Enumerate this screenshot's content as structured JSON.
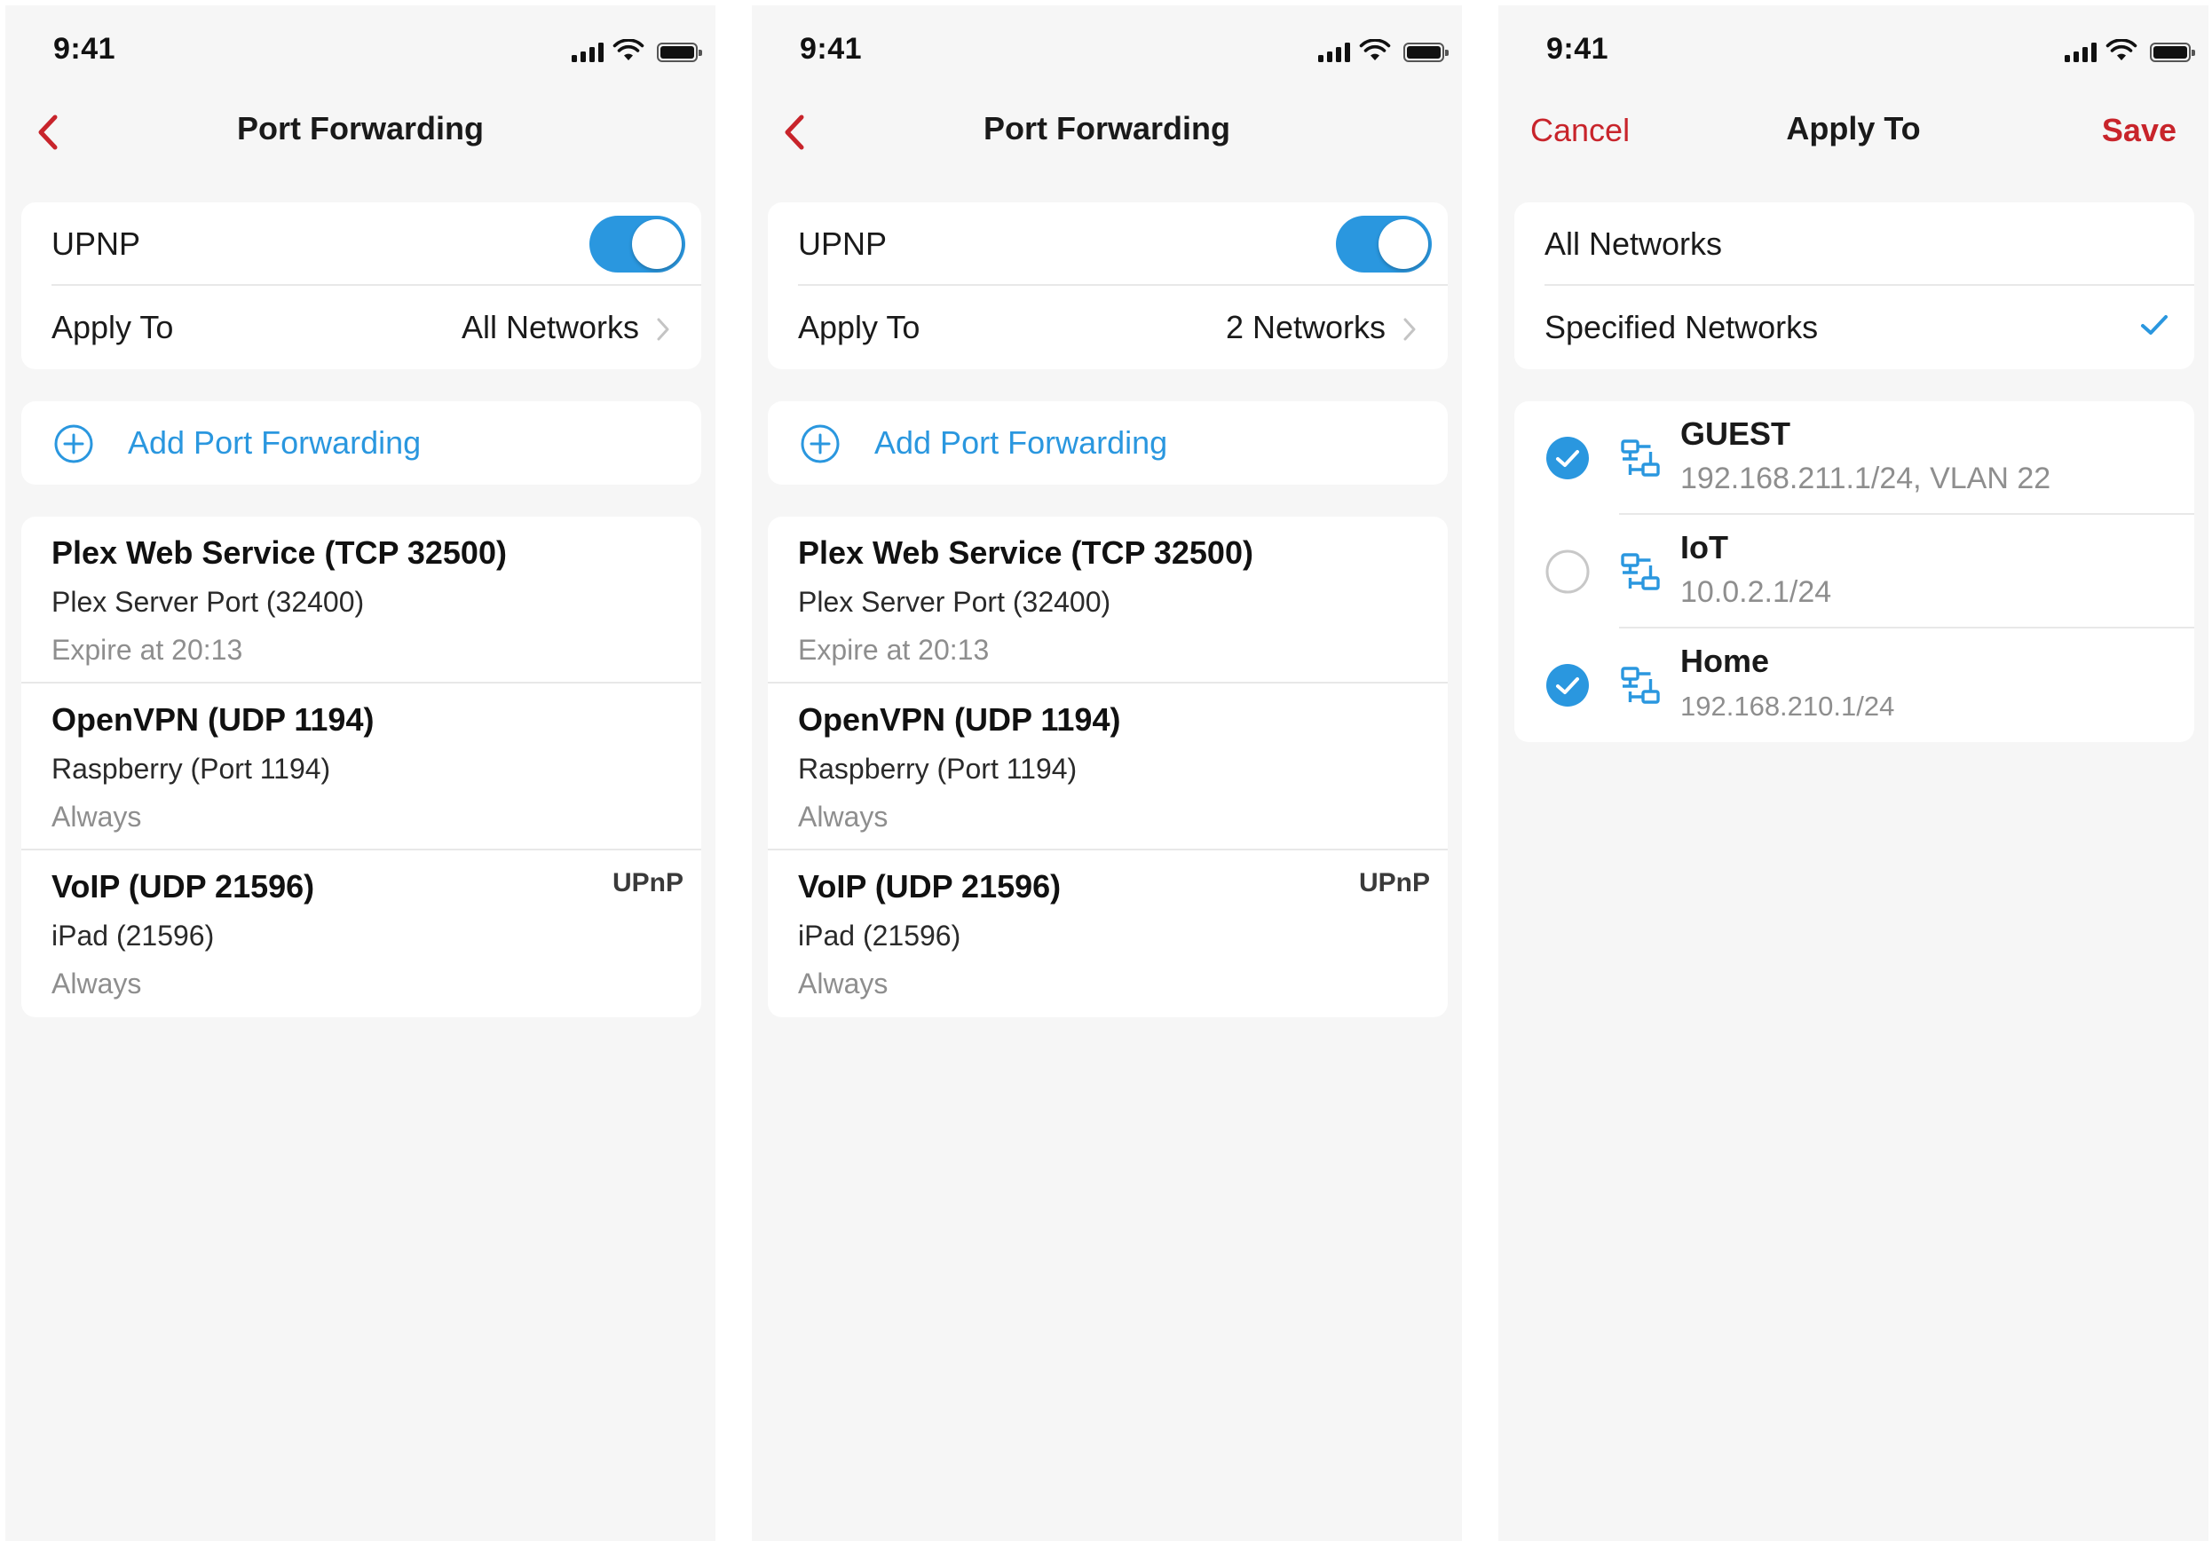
{
  "status_bar": {
    "time": "9:41"
  },
  "screens": [
    {
      "nav_title": "Port Forwarding",
      "upnp_label": "UPNP",
      "apply_to_label": "Apply To",
      "apply_to_value": "All Networks",
      "add_label": "Add Port Forwarding",
      "entries": [
        {
          "title": "Plex Web Service (TCP 32500)",
          "subtitle": "Plex Server Port (32400)",
          "expiry": "Expire at 20:13",
          "badge": ""
        },
        {
          "title": "OpenVPN (UDP 1194)",
          "subtitle": "Raspberry (Port 1194)",
          "expiry": "Always",
          "badge": ""
        },
        {
          "title": "VoIP (UDP 21596)",
          "subtitle": "iPad (21596)",
          "expiry": "Always",
          "badge": "UPnP"
        }
      ]
    },
    {
      "nav_title": "Port Forwarding",
      "upnp_label": "UPNP",
      "apply_to_label": "Apply To",
      "apply_to_value": "2 Networks",
      "add_label": "Add Port Forwarding",
      "entries": [
        {
          "title": "Plex Web Service (TCP 32500)",
          "subtitle": "Plex Server Port (32400)",
          "expiry": "Expire at 20:13",
          "badge": ""
        },
        {
          "title": "OpenVPN (UDP 1194)",
          "subtitle": "Raspberry (Port 1194)",
          "expiry": "Always",
          "badge": ""
        },
        {
          "title": "VoIP (UDP 21596)",
          "subtitle": "iPad (21596)",
          "expiry": "Always",
          "badge": "UPnP"
        }
      ]
    },
    {
      "nav_title": "Apply To",
      "cancel_label": "Cancel",
      "save_label": "Save",
      "options": [
        "All Networks",
        "Specified Networks"
      ],
      "selected_option": "Specified Networks",
      "networks": [
        {
          "name": "GUEST",
          "detail": "192.168.211.1/24, VLAN 22",
          "checked": true
        },
        {
          "name": "IoT",
          "detail": "10.0.2.1/24",
          "checked": false
        },
        {
          "name": "Home",
          "detail": "192.168.210.1/24",
          "checked": true
        }
      ]
    }
  ],
  "colors": {
    "accent_blue": "#2a97df",
    "accent_red": "#c8242b",
    "background": "#f6f6f6",
    "muted_text": "#8e8e8e"
  },
  "icons": [
    "back-chevron-icon",
    "add-circle-icon",
    "chevron-right-icon",
    "checkmark-icon",
    "network-icon",
    "signal-icon",
    "wifi-icon",
    "battery-icon"
  ]
}
